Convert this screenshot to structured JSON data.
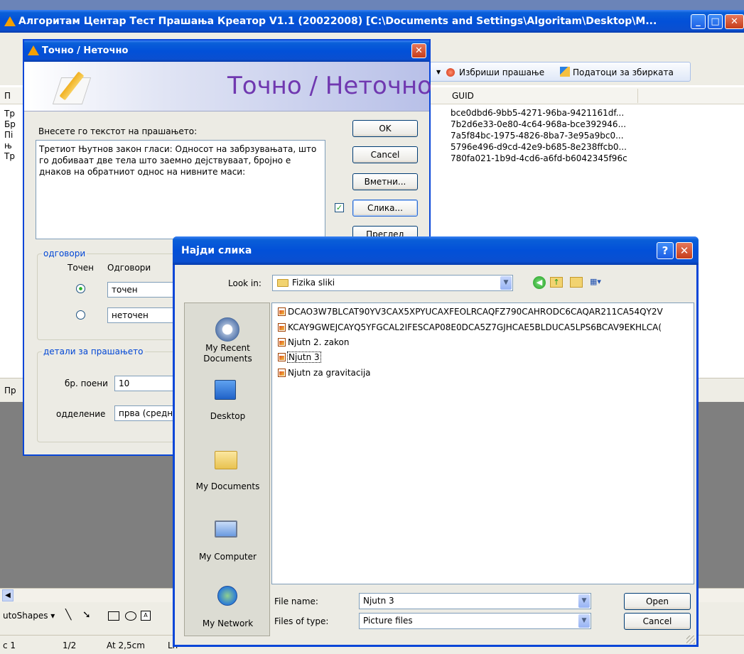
{
  "main_window": {
    "title": "Алгоритам Центар Тест Прашања Креатор V1.1 (20022008) [C:\\Documents and Settings\\Algoritam\\Desktop\\M...",
    "toolbar": {
      "delete_question": "Избриши прашање",
      "collection_data": "Податоци за збирката"
    },
    "grid": {
      "col_left": "П",
      "guid_header": "GUID",
      "guids": [
        "bce0dbd6-9bb5-4271-96ba-9421161df...",
        "7b2d6e33-0e80-4c64-968a-bce392946...",
        "7a5f84bc-1975-4826-8ba7-3e95a9bc0...",
        "5796e496-d9cd-42e9-b685-8e238ffcb0...",
        "780fa021-1b9d-4cd6-a6fd-b6042345f96c"
      ],
      "left_cut": [
        "Тр",
        "Бр",
        "Пі",
        "њ",
        "Тр"
      ]
    },
    "lower_tab": "Пр"
  },
  "tf_dialog": {
    "title": "Точно / Неточно",
    "banner": "Точно / Неточно",
    "prompt": "Внесете го текстот на прашањето:",
    "question_text": "Третиот Њутнов закон гласи: Односот на забрзувањата, што го добиваат две тела што заемно дејствуваат, бројно е днаков на обратниот однос на нивните маси:",
    "buttons": {
      "ok": "OK",
      "cancel": "Cancel",
      "insert": "Вметни...",
      "picture": "Слика...",
      "preview": "Преглед"
    },
    "answers_group": "одговори",
    "col_correct": "Точен",
    "col_answers": "Одговори",
    "answers": [
      "точен",
      "неточен"
    ],
    "details_group": "детали за прашањето",
    "points_label": "бр. поени",
    "points_value": "10",
    "section_label": "одделение",
    "section_value": "прва (средн"
  },
  "file_dialog": {
    "title": "Најди слика",
    "look_in_label": "Look in:",
    "look_in_value": "Fizika sliki",
    "places": [
      "My Recent Documents",
      "Desktop",
      "My Documents",
      "My Computer",
      "My Network"
    ],
    "files": [
      "DCAO3W7BLCAT90YV3CAX5XPYUCAXFEOLRCAQFZ790CAHRODC6CAQAR211CA54QY2V",
      "KCAY9GWEJCAYQ5YFGCAL2IFESCAP08E0DCA5Z7GJHCAE5BLDUCA5LPS6BCAV9EKHLCA(",
      "Njutn 2. zakon",
      "Njutn 3",
      "Njutn za gravitacija"
    ],
    "file_name_label": "File name:",
    "file_name_value": "Njutn 3",
    "file_type_label": "Files of type:",
    "file_type_value": "Picture files",
    "open": "Open",
    "cancel": "Cancel"
  },
  "drawing_bar": {
    "autoshapes": "utoShapes ▾"
  },
  "status_bar": {
    "section": "c 1",
    "page": "1/2",
    "at": "At 2,5cm",
    "ln": "Ln"
  }
}
